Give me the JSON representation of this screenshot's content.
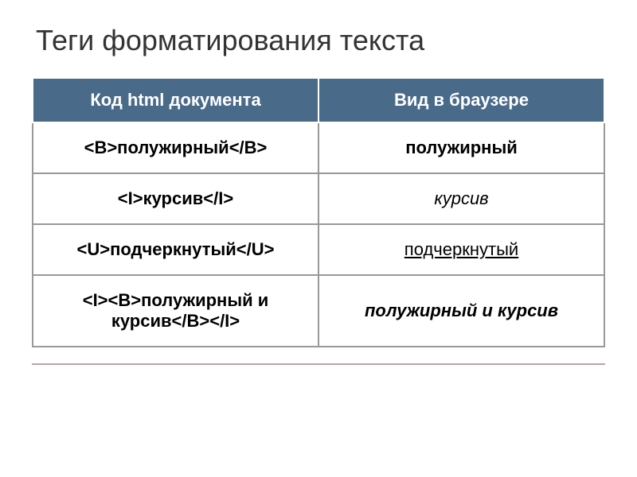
{
  "title": "Теги форматирования текста",
  "table": {
    "headers": {
      "col1": "Код html документа",
      "col2": "Вид в браузере"
    },
    "rows": [
      {
        "code": "<B>полужирный</B>",
        "display": "полужирный",
        "style": "bold"
      },
      {
        "code": "<I>курсив</I>",
        "display": "курсив",
        "style": "italic"
      },
      {
        "code": "<U>подчеркнутый</U>",
        "display": "подчеркнутый",
        "style": "underline"
      },
      {
        "code": "<I><B>полужирный и курсив</B></I>",
        "display": "полужирный и курсив",
        "style": "bold-italic"
      }
    ]
  }
}
